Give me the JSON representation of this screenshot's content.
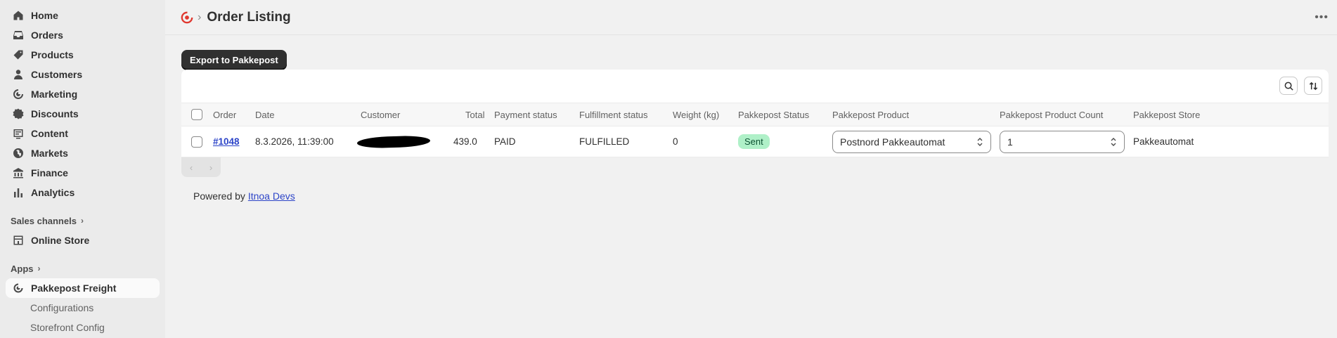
{
  "sidebar": {
    "items": [
      {
        "label": "Home",
        "icon": "home-icon"
      },
      {
        "label": "Orders",
        "icon": "inbox-icon"
      },
      {
        "label": "Products",
        "icon": "tag-icon"
      },
      {
        "label": "Customers",
        "icon": "person-icon"
      },
      {
        "label": "Marketing",
        "icon": "target-icon"
      },
      {
        "label": "Discounts",
        "icon": "discount-icon"
      },
      {
        "label": "Content",
        "icon": "content-icon"
      },
      {
        "label": "Markets",
        "icon": "globe-icon"
      },
      {
        "label": "Finance",
        "icon": "bank-icon"
      },
      {
        "label": "Analytics",
        "icon": "chart-icon"
      }
    ],
    "sales_channels_label": "Sales channels",
    "online_store_label": "Online Store",
    "apps_label": "Apps",
    "app_name": "Pakkepost Freight",
    "app_sub_items": [
      "Configurations",
      "Storefront Config"
    ]
  },
  "header": {
    "separator": "›",
    "title": "Order Listing"
  },
  "actions": {
    "export_label": "Export to Pakkepost"
  },
  "table": {
    "columns": [
      "Order",
      "Date",
      "Customer",
      "Total",
      "Payment status",
      "Fulfillment status",
      "Weight (kg)",
      "Pakkepost Status",
      "Pakkepost Product",
      "Pakkepost Product Count",
      "Pakkepost Store"
    ],
    "rows": [
      {
        "order": "#1048",
        "date": "8.3.2026, 11:39:00",
        "total": "439.0",
        "payment_status": "PAID",
        "fulfillment_status": "FULFILLED",
        "weight": "0",
        "pakkepost_status": "Sent",
        "product": "Postnord Pakkeautomat",
        "product_count": "1",
        "store": "Pakkeautomat"
      }
    ]
  },
  "pagination": {
    "prev": "‹",
    "next": "›"
  },
  "footer": {
    "prefix": "Powered by ",
    "link": "Itnoa Devs"
  },
  "colors": {
    "accent": "#303030",
    "link": "#2c44c8",
    "badge_success_bg": "#aff0c8",
    "badge_success_text": "#0c5132",
    "app_brand": "#e0382f"
  }
}
